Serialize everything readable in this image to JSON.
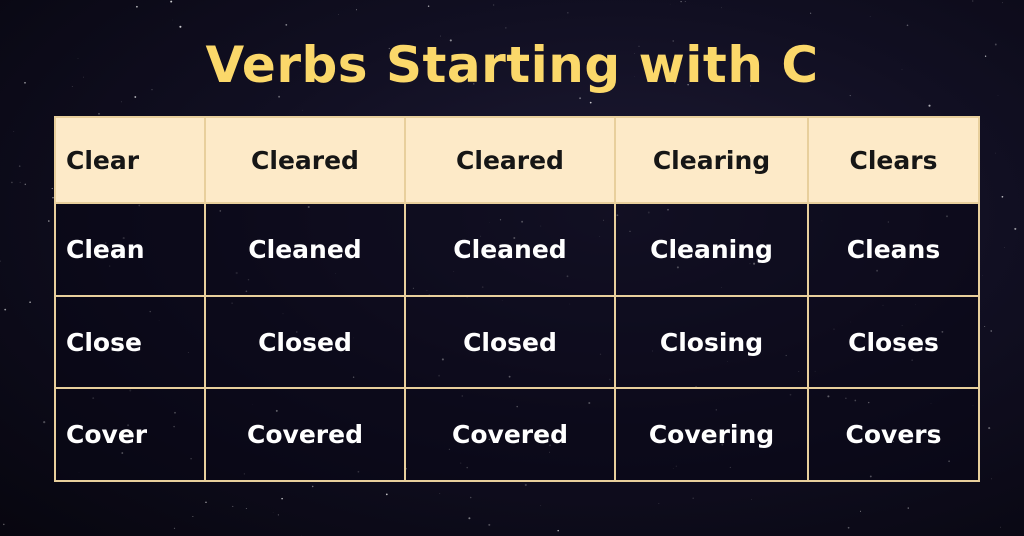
{
  "title": "Verbs Starting with C",
  "colors": {
    "title": "#fbd86a",
    "header_bg": "#fdeac8",
    "border": "#e8cf9c",
    "body_text": "#ffffff"
  },
  "table": {
    "rows": [
      [
        "Clear",
        "Cleared",
        "Cleared",
        "Clearing",
        "Clears"
      ],
      [
        "Clean",
        "Cleaned",
        "Cleaned",
        "Cleaning",
        "Cleans"
      ],
      [
        "Close",
        "Closed",
        "Closed",
        "Closing",
        "Closes"
      ],
      [
        "Cover",
        "Covered",
        "Covered",
        "Covering",
        "Covers"
      ]
    ]
  }
}
